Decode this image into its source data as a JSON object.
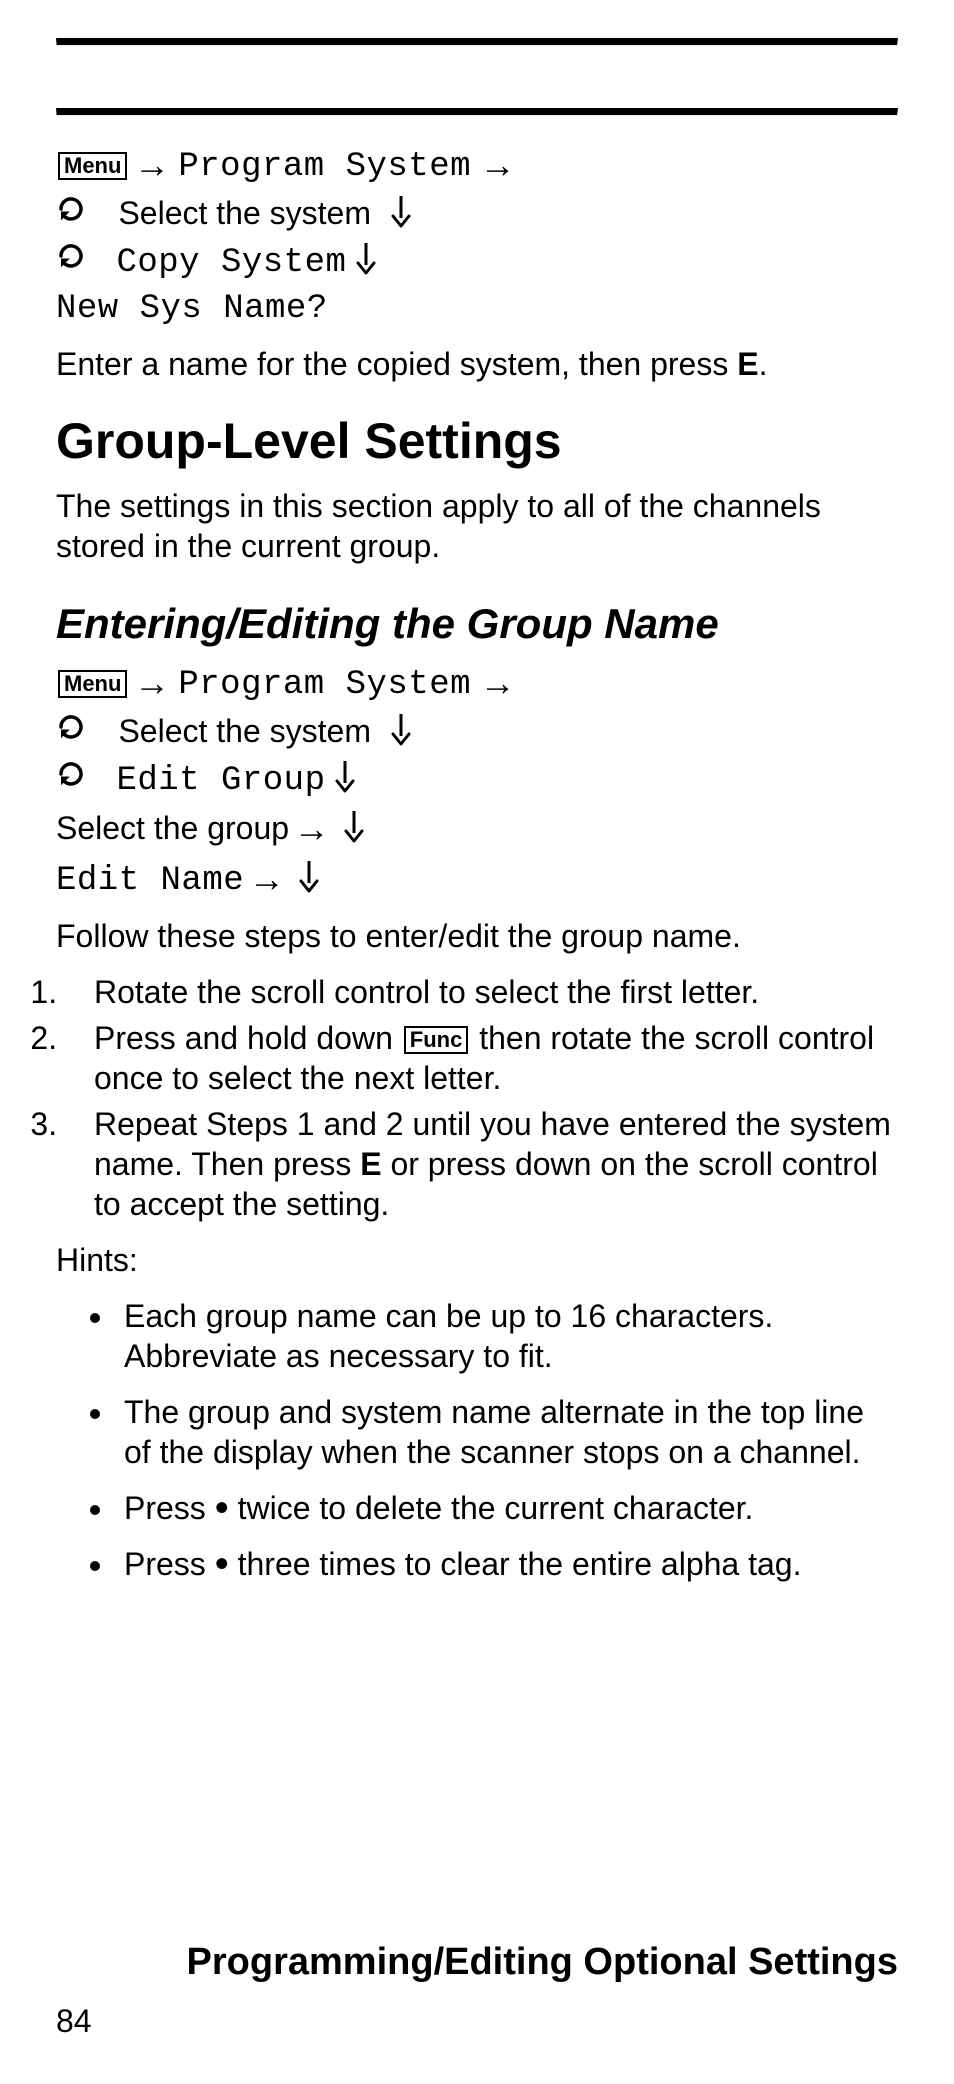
{
  "keys": {
    "menu": "Menu",
    "func": "Func"
  },
  "nav1": {
    "program_system": "Program System",
    "select_system": "Select the system",
    "copy_system": "Copy System",
    "new_sys_name": "New Sys Name?"
  },
  "para1_a": "Enter a name for the copied system, then press ",
  "para1_bold": "E",
  "para1_b": ".",
  "heading1": "Group-Level Settings",
  "para2": "The settings in this section apply to all of the channels stored in the current group.",
  "heading2": "Entering/Editing the Group Name",
  "nav2": {
    "program_system": "Program System",
    "select_system": "Select the system",
    "edit_group": "Edit Group",
    "select_group": "Select the group",
    "edit_name": "Edit Name"
  },
  "para3": "Follow these steps to enter/edit the group name.",
  "steps": [
    "Rotate the scroll control to select the first letter.",
    {
      "a": "Press and hold down ",
      "b": " then rotate the scroll control once to select the next letter."
    },
    {
      "a": "Repeat Steps 1 and 2 until you have entered the system name. Then press ",
      "bold": "E",
      "b": " or press down on the scroll control to accept the setting."
    }
  ],
  "hints_label": "Hints:",
  "hints": [
    "Each group name can be up to 16 characters. Abbreviate as necessary to fit.",
    "The group and system name alternate in the top line of the display when the scanner stops on a channel.",
    {
      "a": "Press ",
      "b": " twice to delete the current character."
    },
    {
      "a": "Press ",
      "b": " three times to clear the entire alpha tag."
    }
  ],
  "footer": "Programming/Editing Optional Settings",
  "page_number": "84"
}
